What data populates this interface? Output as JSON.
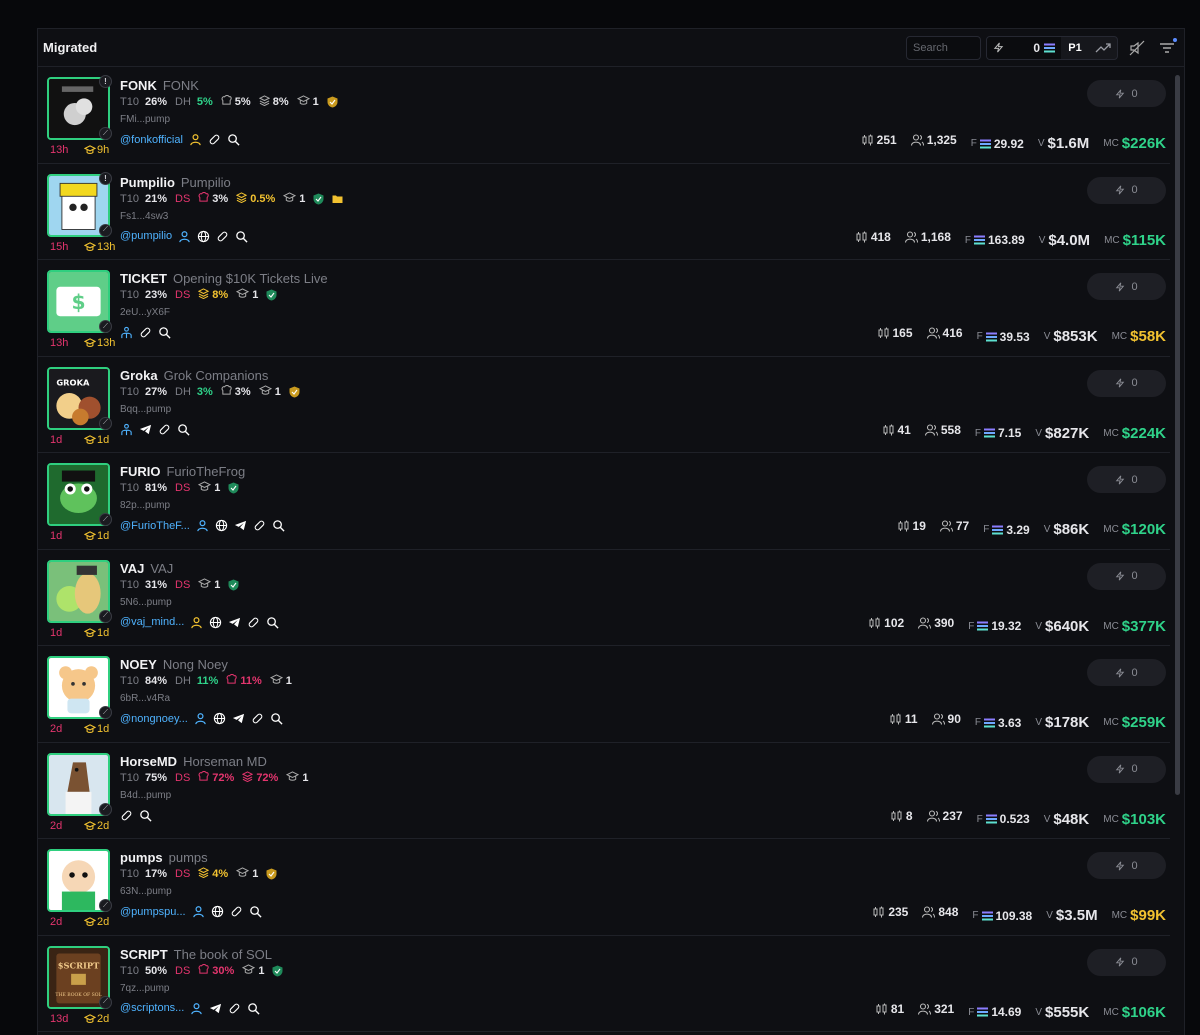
{
  "header": {
    "title": "Migrated",
    "search_placeholder": "Search",
    "amount": "0",
    "preset": "P1"
  },
  "rows": [
    {
      "ticker": "FONK",
      "name": "FONK",
      "t10": "26%",
      "holder_tag": "DH",
      "holder_val": "5%",
      "bundle": "5%",
      "sniper": "8%",
      "grad": "1",
      "address": "FMi...pump",
      "handle": "@fonkofficial",
      "age1": "13h",
      "age2": "9h",
      "candles": "251",
      "holders": "1,325",
      "fees": "29.92",
      "volume": "$1.6M",
      "mc": "$226K",
      "mc_color": "green",
      "buy": "0"
    },
    {
      "ticker": "Pumpilio",
      "name": "Pumpilio",
      "t10": "21%",
      "holder_tag": "DS",
      "holder_val": "",
      "bundle": "3%",
      "sniper": "0.5%",
      "grad": "1",
      "address": "Fs1...4sw3",
      "handle": "@pumpilio",
      "age1": "15h",
      "age2": "13h",
      "candles": "418",
      "holders": "1,168",
      "fees": "163.89",
      "volume": "$4.0M",
      "mc": "$115K",
      "mc_color": "green",
      "buy": "0"
    },
    {
      "ticker": "TICKET",
      "name": "Opening $10K Tickets Live",
      "t10": "23%",
      "holder_tag": "DS",
      "holder_val": "",
      "bundle": "",
      "sniper": "8%",
      "grad": "1",
      "address": "2eU...yX6F",
      "handle": "",
      "age1": "13h",
      "age2": "13h",
      "candles": "165",
      "holders": "416",
      "fees": "39.53",
      "volume": "$853K",
      "mc": "$58K",
      "mc_color": "yellow",
      "buy": "0"
    },
    {
      "ticker": "Groka",
      "name": "Grok Companions",
      "t10": "27%",
      "holder_tag": "DH",
      "holder_val": "3%",
      "bundle": "3%",
      "sniper": "",
      "grad": "1",
      "address": "Bqq...pump",
      "handle": "",
      "age1": "1d",
      "age2": "1d",
      "candles": "41",
      "holders": "558",
      "fees": "7.15",
      "volume": "$827K",
      "mc": "$224K",
      "mc_color": "green",
      "buy": "0"
    },
    {
      "ticker": "FURIO",
      "name": "FurioTheFrog",
      "t10": "81%",
      "holder_tag": "DS",
      "holder_val": "",
      "bundle": "",
      "sniper": "",
      "grad": "1",
      "address": "82p...pump",
      "handle": "@FurioTheF...",
      "age1": "1d",
      "age2": "1d",
      "candles": "19",
      "holders": "77",
      "fees": "3.29",
      "volume": "$86K",
      "mc": "$120K",
      "mc_color": "green",
      "buy": "0"
    },
    {
      "ticker": "VAJ",
      "name": "VAJ",
      "t10": "31%",
      "holder_tag": "DS",
      "holder_val": "",
      "bundle": "",
      "sniper": "",
      "grad": "1",
      "address": "5N6...pump",
      "handle": "@vaj_mind...",
      "age1": "1d",
      "age2": "1d",
      "candles": "102",
      "holders": "390",
      "fees": "19.32",
      "volume": "$640K",
      "mc": "$377K",
      "mc_color": "green",
      "buy": "0"
    },
    {
      "ticker": "NOEY",
      "name": "Nong Noey",
      "t10": "84%",
      "holder_tag": "DH",
      "holder_val": "11%",
      "bundle": "11%",
      "sniper": "",
      "grad": "1",
      "address": "6bR...v4Ra",
      "handle": "@nongnoey...",
      "age1": "2d",
      "age2": "1d",
      "candles": "11",
      "holders": "90",
      "fees": "3.63",
      "volume": "$178K",
      "mc": "$259K",
      "mc_color": "green",
      "buy": "0"
    },
    {
      "ticker": "HorseMD",
      "name": "Horseman MD",
      "t10": "75%",
      "holder_tag": "DS",
      "holder_val": "",
      "bundle": "72%",
      "sniper": "72%",
      "grad": "1",
      "address": "B4d...pump",
      "handle": "",
      "age1": "2d",
      "age2": "2d",
      "candles": "8",
      "holders": "237",
      "fees": "0.523",
      "volume": "$48K",
      "mc": "$103K",
      "mc_color": "green",
      "buy": "0"
    },
    {
      "ticker": "pumps",
      "name": "pumps",
      "t10": "17%",
      "holder_tag": "DS",
      "holder_val": "",
      "bundle": "",
      "sniper": "4%",
      "grad": "1",
      "address": "63N...pump",
      "handle": "@pumpspu...",
      "age1": "2d",
      "age2": "2d",
      "candles": "235",
      "holders": "848",
      "fees": "109.38",
      "volume": "$3.5M",
      "mc": "$99K",
      "mc_color": "yellow",
      "buy": "0"
    },
    {
      "ticker": "SCRIPT",
      "name": "The book of SOL",
      "t10": "50%",
      "holder_tag": "DS",
      "holder_val": "",
      "bundle": "30%",
      "sniper": "",
      "grad": "1",
      "address": "7qz...pump",
      "handle": "@scriptons...",
      "age1": "13d",
      "age2": "2d",
      "candles": "81",
      "holders": "321",
      "fees": "14.69",
      "volume": "$555K",
      "mc": "$106K",
      "mc_color": "green",
      "buy": "0"
    }
  ],
  "labels": {
    "t10": "T10",
    "fees_prefix": "F",
    "vol_prefix": "V",
    "mc_prefix": "MC"
  },
  "colors": {
    "green": "#2fd38a",
    "red": "#e4356e",
    "yellow": "#f2c230",
    "link": "#4fb3ff"
  }
}
